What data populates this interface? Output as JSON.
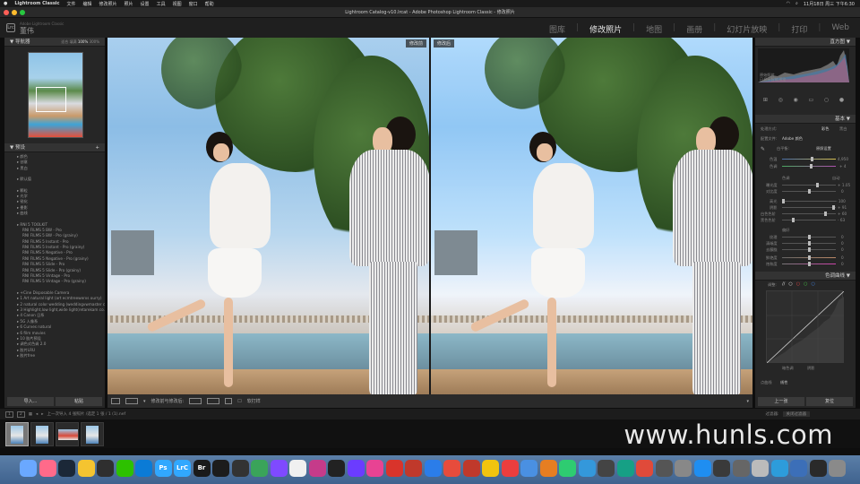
{
  "menubar": {
    "apple": "",
    "items": [
      "Lightroom Classic",
      "文件",
      "编辑",
      "修改照片",
      "照片",
      "设置",
      "工具",
      "视图",
      "窗口",
      "帮助"
    ],
    "clock": "11月18日 周三 下午6:30"
  },
  "window": {
    "title": "Lightroom Catalog-v10.lrcat - Adobe Photoshop Lightroom Classic - 修改照片"
  },
  "identity": {
    "logo": "Lrc",
    "catalog_label": "Adobe Lightroom Classic",
    "user": "董伟",
    "modules": [
      "图库",
      "修改照片",
      "地图",
      "画册",
      "幻灯片放映",
      "打印",
      "Web"
    ],
    "active_module": "修改照片"
  },
  "left_panel": {
    "navigator_title": "导航器",
    "navigator_zoom": [
      "适合",
      "填满",
      "100%",
      "300%"
    ],
    "presets_title": "预设",
    "presets": [
      {
        "t": "folder",
        "label": "▸ 颜色"
      },
      {
        "t": "folder",
        "label": "▸ 创意"
      },
      {
        "t": "folder",
        "label": "▸ 黑白"
      },
      {
        "t": "gap",
        "label": ""
      },
      {
        "t": "folder",
        "label": "▸ 默认值"
      },
      {
        "t": "gap",
        "label": ""
      },
      {
        "t": "folder",
        "label": "▸ 颗粒"
      },
      {
        "t": "folder",
        "label": "▸ 光学"
      },
      {
        "t": "folder",
        "label": "▸ 锐化"
      },
      {
        "t": "folder",
        "label": "▸ 晕影"
      },
      {
        "t": "folder",
        "label": "▸ 曲线"
      },
      {
        "t": "gap",
        "label": ""
      },
      {
        "t": "folder",
        "label": "▸ RNI 5 TOOLKIT"
      },
      {
        "t": "item",
        "label": "RNI FILMS 5 BW - Pro"
      },
      {
        "t": "item",
        "label": "RNI FILMS 5 BW - Pro (grainy)"
      },
      {
        "t": "item",
        "label": "RNI FILMS 5 Instant - Pro"
      },
      {
        "t": "item",
        "label": "RNI FILMS 5 Instant - Pro (grainy)"
      },
      {
        "t": "item",
        "label": "RNI FILMS 5 Negative - Pro"
      },
      {
        "t": "item",
        "label": "RNI FILMS 5 Negative - Pro (grainy)"
      },
      {
        "t": "item",
        "label": "RNI FILMS 5 Slide - Pro"
      },
      {
        "t": "item",
        "label": "RNI FILMS 5 Slide - Pro (grainy)"
      },
      {
        "t": "item",
        "label": "RNI FILMS 5 Vintage - Pro"
      },
      {
        "t": "item",
        "label": "RNI FILMS 5 Vintage - Pro (grainy)"
      },
      {
        "t": "gap",
        "label": ""
      },
      {
        "t": "folder",
        "label": "▸ +Cine Disposable Camera"
      },
      {
        "t": "folder",
        "label": "▸ 1 Art natural light (art ecmtreewerxs ourry)"
      },
      {
        "t": "folder",
        "label": "▸ 2 natural color wedding (weddingvwmaster capsule)"
      },
      {
        "t": "folder",
        "label": "▸ 3 Highlight,low light,wide light(retarekam co...)"
      },
      {
        "t": "folder",
        "label": "▸ 4 Canon 日系"
      },
      {
        "t": "folder",
        "label": "▸ 5G 人像系"
      },
      {
        "t": "folder",
        "label": "▸ 6 Curves natural"
      },
      {
        "t": "folder",
        "label": "▸ 6 film movies"
      },
      {
        "t": "folder",
        "label": "▸ 10 胶片预设"
      },
      {
        "t": "folder",
        "label": "▸ 调色式色调 2.0"
      },
      {
        "t": "folder",
        "label": "▸ 胶片LRU"
      },
      {
        "t": "folder",
        "label": "▸ 胶片free"
      }
    ],
    "import_button": "导入...",
    "export_button": "粘贴"
  },
  "main": {
    "before_label": "修改前",
    "after_label": "修改后"
  },
  "toolbar": {
    "view_mode": "修改前与修改后:",
    "softproof": "软打样"
  },
  "right_panel": {
    "histogram_title": "直方图",
    "original_photo": "原始照片",
    "smart_preview": "已显示智能预览",
    "basic_title": "基本",
    "treatment_label": "处理方式:",
    "treatment_color": "彩色",
    "treatment_bw": "黑白",
    "profile_label": "配置文件:",
    "profile_value": "Adobe 颜色",
    "wb_label": "白平衡:",
    "wb_value": "原照设置",
    "temp_label": "色温",
    "temp_value": "4,950",
    "tint_label": "色调",
    "tint_value": "+ 4",
    "tone_label": "色调",
    "tone_auto": "自动",
    "exposure_label": "曝光度",
    "exposure_value": "+ 1.05",
    "contrast_label": "对比度",
    "contrast_value": "0",
    "highlights_label": "高光",
    "highlights_value": "- 100",
    "shadows_label": "阴影",
    "shadows_value": "+ 91",
    "whites_label": "白色色阶",
    "whites_value": "+ 60",
    "blacks_label": "黑色色阶",
    "blacks_value": "- 63",
    "presence_label": "偏好",
    "texture_label": "纹理",
    "texture_value": "0",
    "clarity_label": "清晰度",
    "clarity_value": "0",
    "dehaze_label": "去朦胧",
    "dehaze_value": "0",
    "vibrance_label": "鲜艳度",
    "vibrance_value": "0",
    "saturation_label": "饱和度",
    "saturation_value": "0",
    "curve_title": "色调曲线",
    "curve_adjust": "调整:",
    "curve_region_dark": "暗色调",
    "curve_region_shadows": "阴影",
    "point_curve_label": "点曲线",
    "point_curve_value": "线性",
    "prev_button": "上一张",
    "reset_button": "复位"
  },
  "filmbar": {
    "pages": [
      "1",
      "2"
    ],
    "source": "上一次导入 4 张照片 /选定 1 张 / 1 (1).nef",
    "filter_label": "过滤器:",
    "filter_value": "关闭过滤器"
  },
  "watermark": "www.hunls.com",
  "dock": {
    "icons": [
      "finder-icon",
      "launchpad-icon",
      "steam-icon",
      "chrome-icon",
      "qq-icon",
      "wechat-icon",
      "edge-icon",
      "ps-icon",
      "lrc-icon",
      "br-icon",
      "1password-icon",
      "obs-icon",
      "app-icon",
      "app-icon",
      "photos-icon",
      "app-icon",
      "app-icon",
      "finalcut-icon",
      "app-icon",
      "app-icon",
      "app-icon",
      "appstore-icon",
      "app-icon",
      "netease-icon",
      "app-icon",
      "app-icon",
      "app-icon",
      "app-icon",
      "app-icon",
      "app-icon",
      "app-icon",
      "app-icon",
      "creative-cloud-icon",
      "app-icon",
      "app-icon",
      "app-icon",
      "app-icon",
      "app-icon",
      "app-icon",
      "folder-icon",
      "app-icon",
      "app-icon",
      "trash-icon"
    ],
    "labels": {
      "ps": "Ps",
      "lrc": "LrC",
      "br": "Br"
    }
  },
  "colors": {
    "dock_top": "#5b7fa8",
    "accent": "#e8e8e8"
  }
}
